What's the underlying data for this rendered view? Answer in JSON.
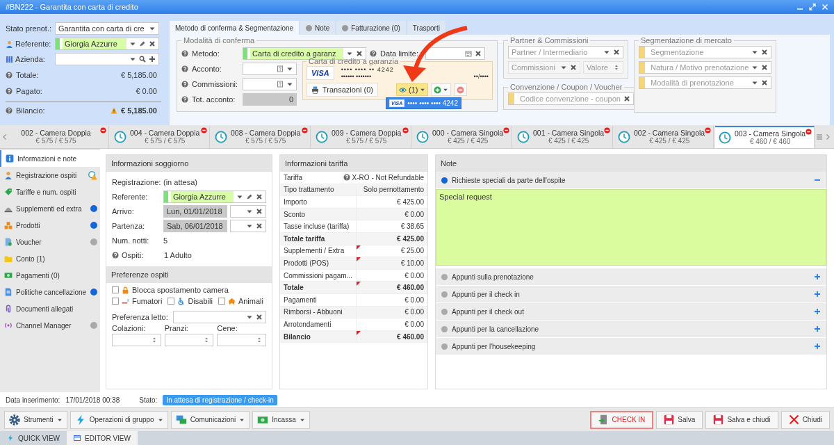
{
  "window": {
    "title": "#BN222 - Garantita con carta di credito"
  },
  "summary": {
    "status": {
      "label": "Stato prenot.:",
      "value": "Garantita con carta di cre"
    },
    "contact": {
      "label": "Referente:",
      "value": "Giorgia Azzurre"
    },
    "company": {
      "label": "Azienda:"
    },
    "totals": [
      {
        "label": "Totale:",
        "value": "€ 5,185.00",
        "warning": false
      },
      {
        "label": "Pagato:",
        "value": "€ 0.00",
        "warning": false
      },
      {
        "label": "Bilancio:",
        "value": "€ 5,185.00",
        "warning": true
      }
    ]
  },
  "header_tabs": [
    {
      "label": "Metodo di conferma & Segmentazione",
      "selected": true,
      "dot": false
    },
    {
      "label": "Note",
      "selected": false,
      "dot": true
    },
    {
      "label": "Fatturazione (0)",
      "selected": false,
      "dot": true
    },
    {
      "label": "Trasporti",
      "selected": false,
      "dot": false
    }
  ],
  "confirmation": {
    "legend": "Modalità di conferma",
    "method_label": "Metodo:",
    "method_value": "Carta di credito a garanz",
    "deadline_label": "Data limite:",
    "deposit_label": "Acconto:",
    "commission_label": "Commissioni:",
    "total_label": "Tot. acconto:",
    "total_value": "0",
    "card": {
      "legend": "Carta di credito a garanzia",
      "brand": "VISA",
      "number": "••••  ••••  ••  4242",
      "holder": "•••••• •••••••",
      "expiry": "••/••••",
      "transactions": "Transazioni (0)",
      "views": "(1)",
      "menu_brand": "VISA",
      "menu_item": "•••• •••• •••• 4242"
    }
  },
  "partner": {
    "legend": "Partner & Commissioni",
    "partner_placeholder": "Partner / Intermediario",
    "commission_placeholder": "Commissioni",
    "value_placeholder": "Valore"
  },
  "coupon": {
    "legend": "Convenzione / Coupon / Voucher",
    "placeholder": "Codice convenzione - coupon"
  },
  "segmentation": {
    "legend": "Segmentazione di mercato",
    "placeholders": [
      "Segmentazione",
      "Natura / Motivo prenotazione",
      "Modalità di prenotazione"
    ]
  },
  "room_tabs": [
    {
      "name": "002 - Camera Doppia",
      "price": "€ 575 / € 575",
      "selected": false,
      "clock": false
    },
    {
      "name": "004 - Camera Doppia",
      "price": "€ 575 / € 575",
      "selected": false,
      "clock": true
    },
    {
      "name": "008 - Camera Doppia",
      "price": "€ 575 / € 575",
      "selected": false,
      "clock": true
    },
    {
      "name": "009 - Camera Doppia",
      "price": "€ 575 / € 575",
      "selected": false,
      "clock": true
    },
    {
      "name": "000 - Camera Singola",
      "price": "€ 425 / € 425",
      "selected": false,
      "clock": true
    },
    {
      "name": "001 - Camera Singola",
      "price": "€ 425 / € 425",
      "selected": false,
      "clock": true
    },
    {
      "name": "002 - Camera Singola",
      "price": "€ 425 / € 425",
      "selected": false,
      "clock": true
    },
    {
      "name": "003 - Camera Singola",
      "price": "€ 460 / € 460",
      "selected": true,
      "clock": true
    }
  ],
  "sidebar": [
    {
      "label": "Informazioni e note",
      "selected": true,
      "kind": "plain"
    },
    {
      "label": "Registrazione ospiti",
      "selected": false,
      "kind": "warning"
    },
    {
      "label": "Tariffe e num. ospiti",
      "selected": false,
      "kind": "plain"
    },
    {
      "label": "Supplementi ed extra",
      "selected": false,
      "kind": "dot",
      "color": "#1565d8"
    },
    {
      "label": "Prodotti",
      "selected": false,
      "kind": "dot",
      "color": "#1565d8"
    },
    {
      "label": "Voucher",
      "selected": false,
      "kind": "dot",
      "color": "#aaaaaa"
    },
    {
      "label": "Conto (1)",
      "selected": false,
      "kind": "plain"
    },
    {
      "label": "Pagamenti (0)",
      "selected": false,
      "kind": "plain"
    },
    {
      "label": "Politiche cancellazione",
      "selected": false,
      "kind": "dot",
      "color": "#1565d8"
    },
    {
      "label": "Documenti allegati",
      "selected": false,
      "kind": "plain"
    },
    {
      "label": "Channel Manager",
      "selected": false,
      "kind": "dot",
      "color": "#aaaaaa"
    }
  ],
  "stay": {
    "title": "Informazioni soggiorno",
    "registration": {
      "label": "Registrazione:",
      "value": "(in attesa)"
    },
    "contact": {
      "label": "Referente:",
      "value": "Giorgia Azzurre"
    },
    "arrival": {
      "label": "Arrivo:",
      "value": "Lun, 01/01/2018"
    },
    "departure": {
      "label": "Partenza:",
      "value": "Sab, 06/01/2018"
    },
    "nights": {
      "label": "Num. notti:",
      "value": "5"
    },
    "guests": {
      "label": "Ospiti:",
      "value": "1 Adulto"
    },
    "prefs_title": "Preferenze ospiti",
    "options": [
      {
        "label": "Blocca spostamento camera",
        "checked": false
      },
      {
        "label": "Fumatori",
        "checked": false
      },
      {
        "label": "Disabili",
        "checked": false
      },
      {
        "label": "Animali",
        "checked": false
      }
    ],
    "bed_label": "Preferenza letto:",
    "meals": [
      "Colazioni:",
      "Pranzi:",
      "Cene:"
    ]
  },
  "tariff": {
    "title": "Informazioni tariffa",
    "rows": [
      {
        "label": "Tariffa",
        "value": "X-RO - Not Refundable",
        "bold": false,
        "flag": false,
        "help": true
      },
      {
        "label": "Tipo trattamento",
        "value": "Solo pernottamento",
        "bold": false,
        "flag": false,
        "help": false
      },
      {
        "label": "Importo",
        "value": "€ 425.00",
        "bold": false,
        "flag": false,
        "help": false
      },
      {
        "label": "Sconto",
        "value": "€ 0.00",
        "bold": false,
        "flag": false,
        "help": false
      },
      {
        "label": "Tasse incluse (tariffa)",
        "value": "€ 38.65",
        "bold": false,
        "flag": false,
        "help": false
      },
      {
        "label": "Totale tariffa",
        "value": "€ 425.00",
        "bold": true,
        "flag": false,
        "help": false
      },
      {
        "label": "Supplementi / Extra",
        "value": "€ 25.00",
        "bold": false,
        "flag": true,
        "help": false
      },
      {
        "label": "Prodotti (POS)",
        "value": "€ 10.00",
        "bold": false,
        "flag": true,
        "help": false
      },
      {
        "label": "Commissioni pagam...",
        "value": "€ 0.00",
        "bold": false,
        "flag": false,
        "help": false
      },
      {
        "label": "Totale",
        "value": "€ 460.00",
        "bold": true,
        "flag": true,
        "help": false
      },
      {
        "label": "Pagamenti",
        "value": "€ 0.00",
        "bold": false,
        "flag": false,
        "help": false
      },
      {
        "label": "Rimborsi - Abbuoni",
        "value": "€ 0.00",
        "bold": false,
        "flag": false,
        "help": false
      },
      {
        "label": "Arrotondamenti",
        "value": "€ 0.00",
        "bold": false,
        "flag": false,
        "help": false
      },
      {
        "label": "Bilancio",
        "value": "€ 460.00",
        "bold": true,
        "flag": true,
        "help": false
      }
    ]
  },
  "notes": {
    "title": "Note",
    "sections": [
      {
        "label": "Richieste speciali da parte dell'ospite",
        "expanded": true,
        "color": "#1565d8",
        "content": "Special request"
      },
      {
        "label": "Appunti sulla prenotazione",
        "expanded": false,
        "color": "#aaaaaa"
      },
      {
        "label": "Appunti per il check in",
        "expanded": false,
        "color": "#aaaaaa"
      },
      {
        "label": "Appunti per il check out",
        "expanded": false,
        "color": "#aaaaaa"
      },
      {
        "label": "Appunti per la cancellazione",
        "expanded": false,
        "color": "#aaaaaa"
      },
      {
        "label": "Appunti per l'housekeeping",
        "expanded": false,
        "color": "#aaaaaa"
      }
    ]
  },
  "status_bar": {
    "inserted_label": "Data inserimento:",
    "inserted_value": "17/01/2018 00:38",
    "state_label": "Stato:",
    "state_value": "In attesa di registrazione / check-in"
  },
  "toolbar": {
    "left": [
      {
        "label": "Strumenti",
        "kind": "tools"
      },
      {
        "label": "Operazioni di gruppo",
        "kind": "group"
      },
      {
        "label": "Comunicazioni",
        "kind": "messages"
      },
      {
        "label": "Incassa",
        "kind": "cash"
      }
    ],
    "right": [
      {
        "label": "CHECK IN",
        "kind": "checkin",
        "highlighted": true
      },
      {
        "label": "Salva",
        "kind": "save",
        "highlighted": false
      },
      {
        "label": "Salva e chiudi",
        "kind": "save",
        "highlighted": false
      },
      {
        "label": "Chiudi",
        "kind": "close",
        "highlighted": false
      }
    ]
  },
  "view_tabs": [
    {
      "label": "QUICK VIEW",
      "selected": false,
      "kind": "quick"
    },
    {
      "label": "EDITOR VIEW",
      "selected": true,
      "kind": "editor"
    }
  ]
}
